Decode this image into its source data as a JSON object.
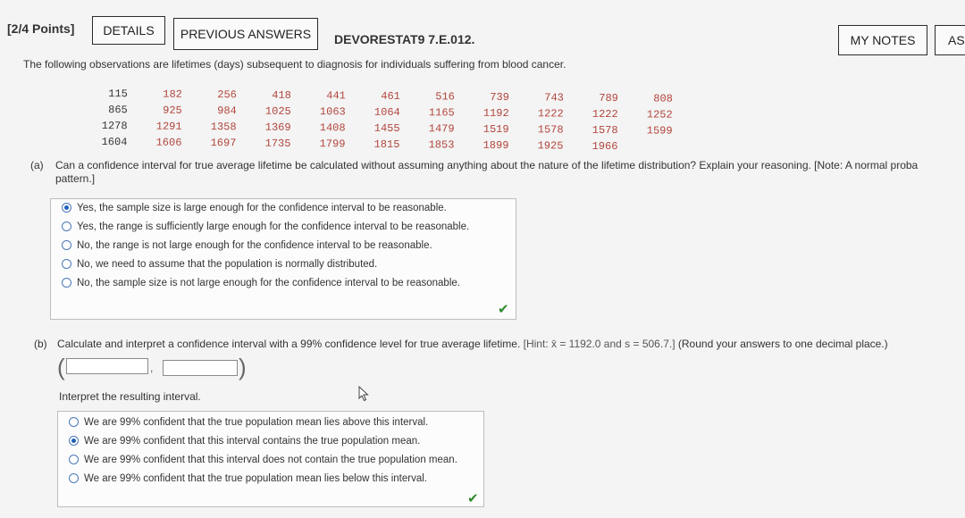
{
  "header": {
    "points": "[2/4 Points]",
    "details_label": "DETAILS",
    "previous_answers_label": "PREVIOUS ANSWERS",
    "question_id": "DEVORESTAT9 7.E.012.",
    "my_notes_label": "MY NOTES",
    "ask_label": "AS"
  },
  "intro": "The following observations are lifetimes (days) subsequent to diagnosis for individuals suffering from blood cancer.",
  "observations": [
    [
      "115",
      "182",
      "256",
      "418",
      "441",
      "461",
      "516",
      "739",
      "743",
      "789",
      "808"
    ],
    [
      "865",
      "925",
      "984",
      "1025",
      "1063",
      "1064",
      "1165",
      "1192",
      "1222",
      "1222",
      "1252"
    ],
    [
      "1278",
      "1291",
      "1358",
      "1369",
      "1408",
      "1455",
      "1479",
      "1519",
      "1578",
      "1578",
      "1599"
    ],
    [
      "1604",
      "1606",
      "1697",
      "1735",
      "1799",
      "1815",
      "1853",
      "1899",
      "1925",
      "1966"
    ]
  ],
  "part_a": {
    "label": "(a)",
    "question_line1": "Can a confidence interval for true average lifetime be calculated without assuming anything about the nature of the lifetime distribution? Explain your reasoning. [Note: A normal proba",
    "question_line2": "pattern.]",
    "options": [
      "Yes, the sample size is large enough for the confidence interval to be reasonable.",
      "Yes, the range is sufficiently large enough for the confidence interval to be reasonable.",
      "No, the range is not large enough for the confidence interval to be reasonable.",
      "No, we need to assume that the population is normally distributed.",
      "No, the sample size is not large enough for the confidence interval to be reasonable."
    ],
    "selected_index": 0
  },
  "part_b": {
    "label": "(b)",
    "question": "Calculate and interpret a confidence interval with a 99% confidence level for true average lifetime.",
    "hint": "[Hint: x̄ = 1192.0 and s = 506.7.]",
    "round_note": "(Round your answers to one decimal place.)",
    "lower_value": "",
    "upper_value": "",
    "interpret_label": "Interpret the resulting interval.",
    "options": [
      "We are 99% confident that the true population mean lies above this interval.",
      "We are 99% confident that this interval contains the true population mean.",
      "We are 99% confident that this interval does not contain the true population mean.",
      "We are 99% confident that the true population mean lies below this interval."
    ],
    "selected_index": 1
  },
  "icons": {
    "correct": "check-icon",
    "pointer": "mouse-cursor-icon"
  },
  "colors": {
    "correct_check": "#2e8b2e",
    "radio_selected": "#1f5fb7",
    "data_value": "#b0443a"
  }
}
